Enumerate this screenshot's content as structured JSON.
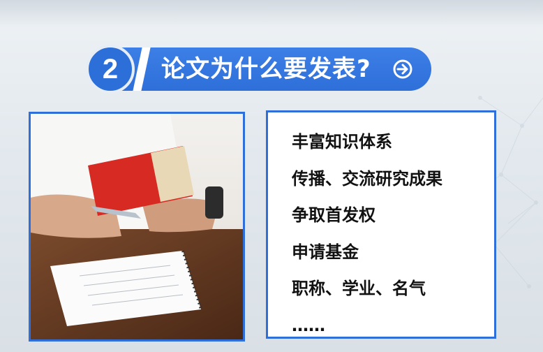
{
  "heading": {
    "number": "2",
    "title": "论文为什么要发表?",
    "icon": "arrow-right-circle-icon"
  },
  "photo": {
    "description_icon": "hand-holding-notebook-photo"
  },
  "reasons": {
    "items": [
      "丰富知识体系",
      "传播、交流研究成果",
      "争取首发权",
      "申请基金",
      "职称、学业、名气",
      "……"
    ]
  },
  "colors": {
    "accent": "#2e6fd9",
    "background": "#e3e9ee"
  }
}
